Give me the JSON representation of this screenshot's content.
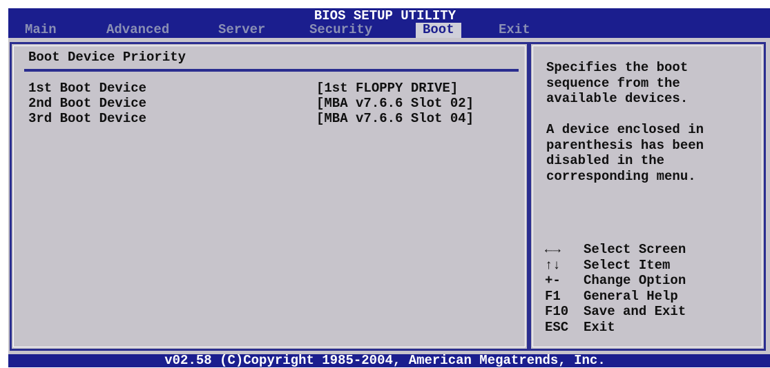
{
  "header": {
    "title": "BIOS SETUP UTILITY",
    "tabs": [
      {
        "label": "Main"
      },
      {
        "label": "Advanced"
      },
      {
        "label": "Server"
      },
      {
        "label": "Security"
      },
      {
        "label": "Boot"
      },
      {
        "label": "Exit"
      }
    ],
    "active_tab": "Boot"
  },
  "main": {
    "section_title": "Boot Device Priority",
    "rows": [
      {
        "label": "1st Boot Device",
        "value": "[1st FLOPPY DRIVE]"
      },
      {
        "label": "2nd Boot Device",
        "value": "[MBA v7.6.6 Slot 02]"
      },
      {
        "label": "3rd Boot Device",
        "value": "[MBA v7.6.6 Slot 04]"
      }
    ]
  },
  "help": {
    "text": "Specifies the boot\nsequence from the\navailable devices.\n\nA device enclosed in\nparenthesis has been\ndisabled in the\ncorresponding menu."
  },
  "legend": [
    {
      "key": "←→",
      "desc": "Select Screen",
      "icon": "left-right-arrows-icon"
    },
    {
      "key": "↑↓",
      "desc": "Select Item",
      "icon": "up-down-arrows-icon"
    },
    {
      "key": "+-",
      "desc": "Change Option"
    },
    {
      "key": "F1",
      "desc": "General Help"
    },
    {
      "key": "F10",
      "desc": "Save and Exit"
    },
    {
      "key": "ESC",
      "desc": "Exit"
    }
  ],
  "footer": {
    "text": "v02.58 (C)Copyright 1985-2004, American Megatrends, Inc."
  },
  "colors": {
    "header_bg": "#1b1e8e",
    "panel_bg": "#c7c4cb",
    "frame": "#2a2d8f",
    "inactive_tab": "#8a8fb4",
    "active_tab_bg": "#cfcfd9"
  }
}
